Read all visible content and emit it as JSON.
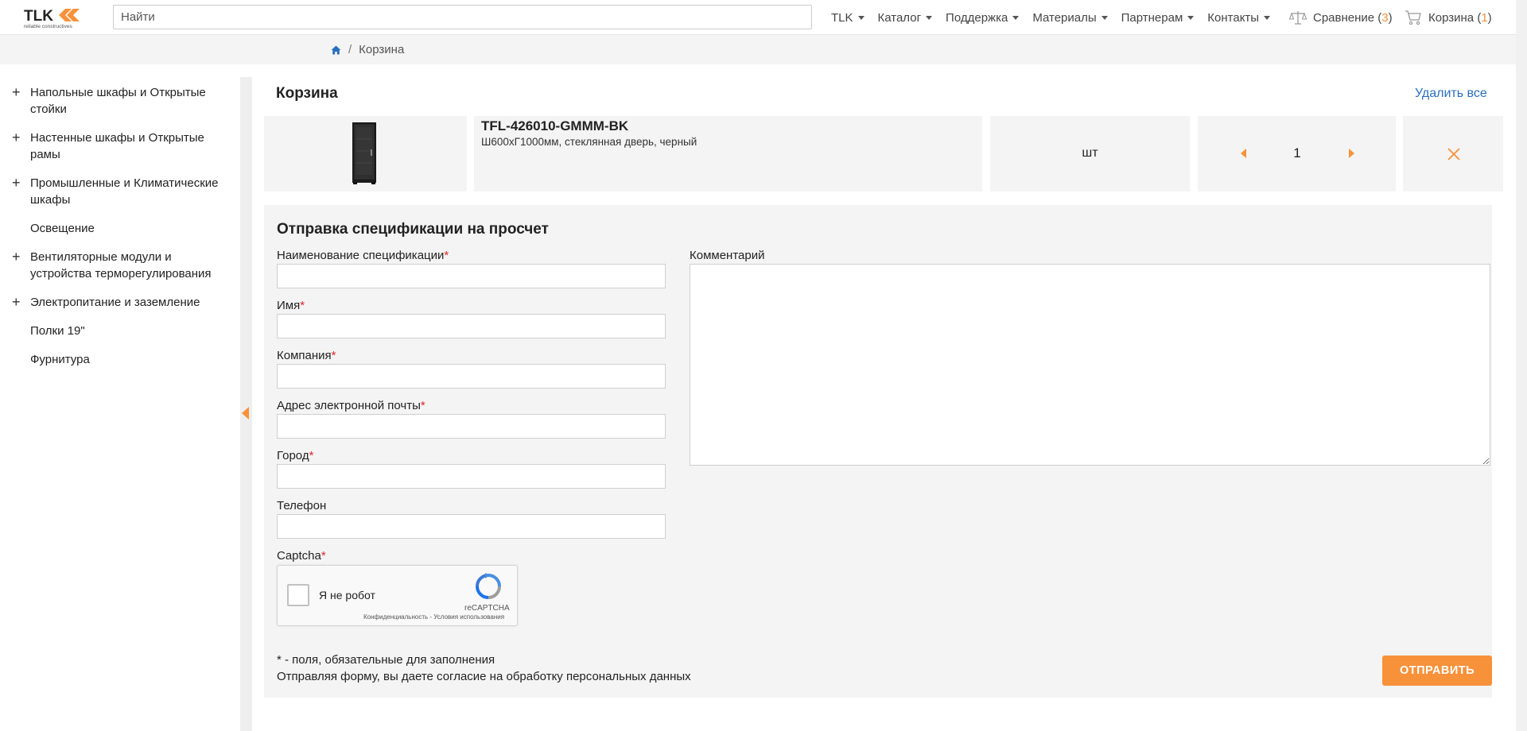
{
  "brand": {
    "logo_text": "TLK",
    "logo_tagline": "reliable constructives",
    "accent_color": "#f7913a",
    "link_color": "#2a6fbd",
    "required_color": "#e0242b"
  },
  "header": {
    "search_placeholder": "Найти",
    "nav": [
      "TLK",
      "Каталог",
      "Поддержка",
      "Материалы",
      "Партнерам",
      "Контакты"
    ],
    "compare_label": "Сравнение",
    "compare_count": "3",
    "cart_label": "Корзина",
    "cart_count": "1",
    "paren_open": "(",
    "paren_close": ")"
  },
  "breadcrumb": {
    "home_icon": "home-icon",
    "separator": "/",
    "current": "Корзина"
  },
  "sidebar": {
    "items": [
      {
        "label": "Напольные шкафы и Открытые стойки",
        "expandable": true
      },
      {
        "label": "Настенные шкафы и Открытые рамы",
        "expandable": true
      },
      {
        "label": "Промышленные и Климатические шкафы",
        "expandable": true
      },
      {
        "label": "Освещение",
        "expandable": false
      },
      {
        "label": "Вентиляторные модули и устройства терморегулирования",
        "expandable": true
      },
      {
        "label": "Электропитание и заземление",
        "expandable": true
      },
      {
        "label": "Полки 19\"",
        "expandable": false
      },
      {
        "label": "Фурнитура",
        "expandable": false
      }
    ],
    "plus_glyph": "+"
  },
  "cart": {
    "title": "Корзина",
    "delete_all": "Удалить все",
    "item": {
      "sku": "TFL-426010-GMMM-BK",
      "description": "Ш600хГ1000мм, стеклянная дверь, черный",
      "unit": "шт",
      "quantity": "1"
    }
  },
  "form": {
    "title": "Отправка спецификации на просчет",
    "required_mark": "*",
    "fields": [
      {
        "label": "Наименование спецификации",
        "required": true,
        "value": ""
      },
      {
        "label": "Имя",
        "required": true,
        "value": ""
      },
      {
        "label": "Компания",
        "required": true,
        "value": ""
      },
      {
        "label": "Адрес электронной почты",
        "required": true,
        "value": ""
      },
      {
        "label": "Город",
        "required": true,
        "value": ""
      },
      {
        "label": "Телефон",
        "required": false,
        "value": ""
      }
    ],
    "comment_label": "Комментарий",
    "comment_value": "",
    "captcha_label": "Captcha",
    "captcha": {
      "checkbox_text": "Я не робот",
      "brand": "reCAPTCHA",
      "links": "Конфиденциальность - Условия использования"
    },
    "note_required": "* - поля, обязательные для заполнения",
    "note_consent": "Отправляя форму, вы даете согласие на обработку персональных данных",
    "submit_label": "ОТПРАВИТЬ"
  }
}
